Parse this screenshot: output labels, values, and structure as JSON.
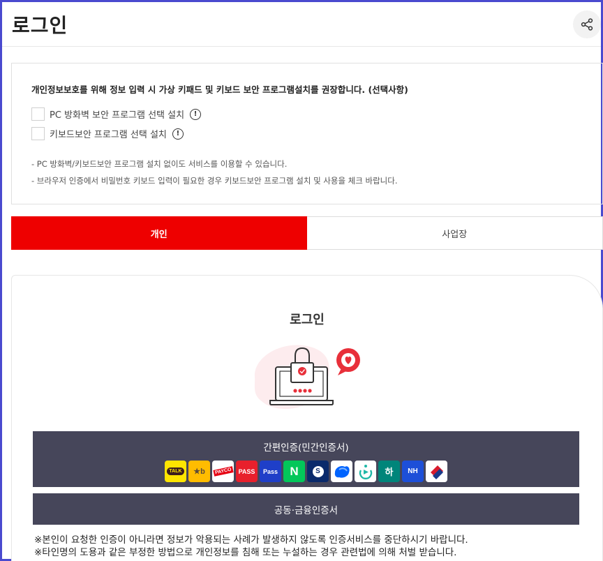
{
  "header": {
    "title": "로그인",
    "share_icon": "share-icon"
  },
  "notice": {
    "title": "개인정보보호를 위해 정보 입력 시 가상 키패드 및 키보드 보안 프로그램설치를 권장합니다. (선택사항)",
    "options": [
      {
        "label": "PC 방화벽 보안 프로그램 선택 설치",
        "checked": false
      },
      {
        "label": "키보드보안 프로그램 선택 설치",
        "checked": false
      }
    ],
    "info_glyph": "!",
    "notes": [
      "-  PC 방화벽/키보드보안 프로그램 설치 없이도 서비스를 이용할 수 있습니다.",
      "-  브라우저 인증에서 비밀번호 키보드 입력이 필요한 경우 키보드보안 프로그램 설치 및 사용을 체크 바랍니다."
    ]
  },
  "tabs": [
    {
      "label": "개인",
      "active": true
    },
    {
      "label": "사업장",
      "active": false
    }
  ],
  "login": {
    "title": "로그인",
    "simple_auth_label": "간편인증(민간인증서)",
    "cert_label": "공동·금융인증서",
    "providers": [
      {
        "name": "kakao-icon",
        "text": "TALK",
        "bg": "#fee500",
        "fg": "#3c1e1e"
      },
      {
        "name": "kb-icon",
        "text": "★b",
        "bg": "#ffbc00",
        "fg": "#5a4a3a"
      },
      {
        "name": "payco-icon",
        "text": "PAYCO",
        "bg": "#ffffff",
        "fg": "#e60012"
      },
      {
        "name": "pass-icon",
        "text": "PASS",
        "bg": "#e8202c",
        "fg": "#ffffff"
      },
      {
        "name": "samsung-pass-icon",
        "text": "Pass",
        "bg": "#1f3fc8",
        "fg": "#ffffff"
      },
      {
        "name": "naver-icon",
        "text": "N",
        "bg": "#03c75a",
        "fg": "#ffffff"
      },
      {
        "name": "shinhan-icon",
        "text": "S",
        "bg": "#0a2a6b",
        "fg": "#ffffff"
      },
      {
        "name": "toss-icon",
        "text": "",
        "bg": "#ffffff",
        "fg": "#0064ff"
      },
      {
        "name": "woori-icon",
        "text": "",
        "bg": "#ffffff",
        "fg": "#1fb8a8"
      },
      {
        "name": "hana-icon",
        "text": "하",
        "bg": "#00857a",
        "fg": "#ffffff"
      },
      {
        "name": "nh-icon",
        "text": "NH",
        "bg": "#1d4fd8",
        "fg": "#ffffff"
      },
      {
        "name": "bank-card-icon",
        "text": "",
        "bg": "#ffffff",
        "fg": "#d81b2c"
      }
    ],
    "warnings": [
      "※본인이 요청한 인증이 아니라면 정보가 악용되는 사례가 발생하지 않도록 인증서비스를 중단하시기 바랍니다.",
      "※타인명의 도용과 같은 부정한 방법으로 개인정보를 침해 또는 누설하는 경우 관련법에 의해 처벌 받습니다."
    ]
  },
  "colors": {
    "accent": "#ee0000",
    "button_dark": "#46465a"
  }
}
